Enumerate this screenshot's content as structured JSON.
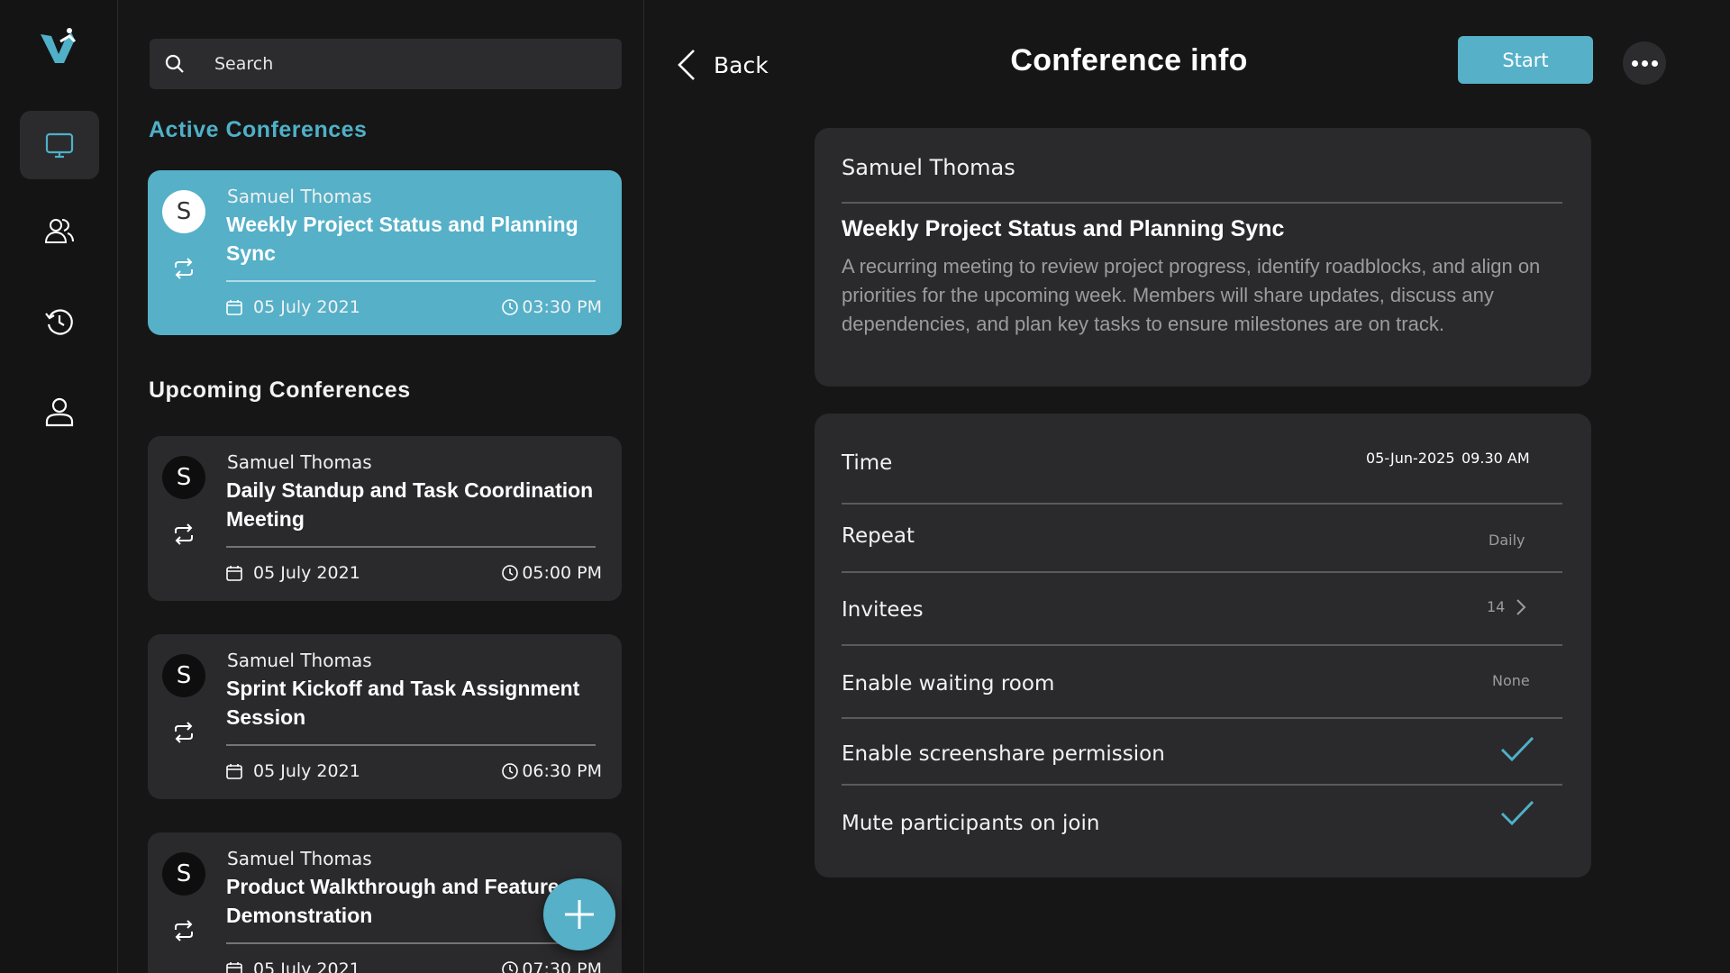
{
  "colors": {
    "accent": "#55b0c8",
    "accent_text": "#4fb0c8",
    "background": "#161616",
    "card": "#2a2a2c",
    "muted_text": "#9c9c9c"
  },
  "rail": {
    "items": [
      {
        "icon": "monitor-icon",
        "active": true
      },
      {
        "icon": "contacts-icon",
        "active": false
      },
      {
        "icon": "history-icon",
        "active": false
      },
      {
        "icon": "profile-icon",
        "active": false
      }
    ]
  },
  "search": {
    "placeholder": "Search"
  },
  "sections": {
    "active_title": "Active Conferences",
    "upcoming_title": "Upcoming Conferences"
  },
  "active_conference": {
    "initial": "S",
    "owner": "Samuel Thomas",
    "title": "Weekly Project Status and Planning Sync",
    "date": "05 July 2021",
    "time": "03:30 PM"
  },
  "upcoming_conferences": [
    {
      "initial": "S",
      "owner": "Samuel Thomas",
      "title": "Daily Standup and Task Coordination Meeting",
      "date": "05 July 2021",
      "time": "05:00 PM"
    },
    {
      "initial": "S",
      "owner": "Samuel Thomas",
      "title": "Sprint Kickoff and Task Assignment Session",
      "date": "05 July 2021",
      "time": "06:30 PM"
    },
    {
      "initial": "S",
      "owner": "Samuel Thomas",
      "title": "Product Walkthrough and Feature Demonstration",
      "date": "05 July 2021",
      "time": "07:30 PM"
    }
  ],
  "header": {
    "back_label": "Back",
    "title": "Conference info",
    "start_label": "Start"
  },
  "info": {
    "owner": "Samuel Thomas",
    "title": "Weekly Project Status and Planning Sync",
    "description": "A recurring meeting to review project progress, identify roadblocks, and align on priorities for the upcoming week. Members will share updates, discuss any dependencies, and plan key tasks to ensure milestones are on track."
  },
  "settings": {
    "time_label": "Time",
    "time_date": "05-Jun-2025",
    "time_value": "09.30 AM",
    "repeat_label": "Repeat",
    "repeat_value": "Daily",
    "invitees_label": "Invitees",
    "invitees_value": "14",
    "waiting_label": "Enable waiting room",
    "waiting_value": "None",
    "screenshare_label": "Enable screenshare permission",
    "screenshare_enabled": true,
    "mute_label": "Mute participants on join",
    "mute_enabled": true
  }
}
